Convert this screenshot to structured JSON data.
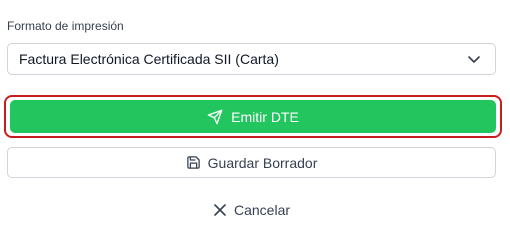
{
  "print_format": {
    "label": "Formato de impresión",
    "selected": "Factura Electrónica Certificada SII (Carta)"
  },
  "actions": {
    "emit_label": "Emitir DTE",
    "save_draft_label": "Guardar Borrador",
    "cancel_label": "Cancelar"
  },
  "icons": {
    "select": "chevron-down-icon",
    "emit": "send-icon",
    "save_draft": "save-icon",
    "cancel": "close-icon"
  },
  "colors": {
    "primary": "#22c55e",
    "highlight_ring": "#c81d1d",
    "border": "#d1d5db"
  }
}
